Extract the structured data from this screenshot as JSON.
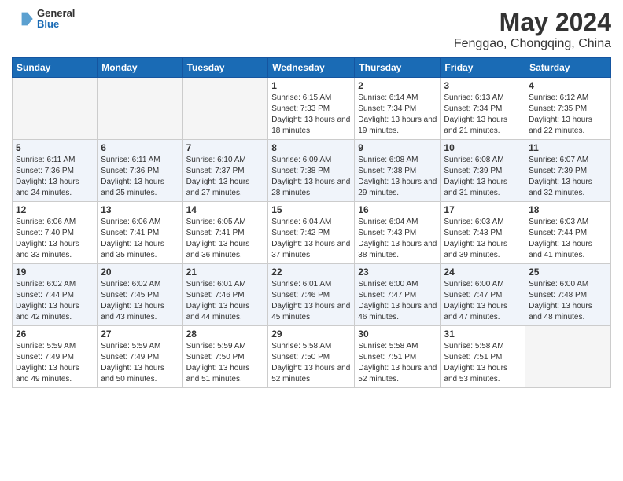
{
  "header": {
    "logo_general": "General",
    "logo_blue": "Blue",
    "title": "May 2024",
    "location": "Fenggao, Chongqing, China"
  },
  "weekdays": [
    "Sunday",
    "Monday",
    "Tuesday",
    "Wednesday",
    "Thursday",
    "Friday",
    "Saturday"
  ],
  "weeks": [
    [
      {
        "day": "",
        "info": ""
      },
      {
        "day": "",
        "info": ""
      },
      {
        "day": "",
        "info": ""
      },
      {
        "day": "1",
        "info": "Sunrise: 6:15 AM\nSunset: 7:33 PM\nDaylight: 13 hours and 18 minutes."
      },
      {
        "day": "2",
        "info": "Sunrise: 6:14 AM\nSunset: 7:34 PM\nDaylight: 13 hours and 19 minutes."
      },
      {
        "day": "3",
        "info": "Sunrise: 6:13 AM\nSunset: 7:34 PM\nDaylight: 13 hours and 21 minutes."
      },
      {
        "day": "4",
        "info": "Sunrise: 6:12 AM\nSunset: 7:35 PM\nDaylight: 13 hours and 22 minutes."
      }
    ],
    [
      {
        "day": "5",
        "info": "Sunrise: 6:11 AM\nSunset: 7:36 PM\nDaylight: 13 hours and 24 minutes."
      },
      {
        "day": "6",
        "info": "Sunrise: 6:11 AM\nSunset: 7:36 PM\nDaylight: 13 hours and 25 minutes."
      },
      {
        "day": "7",
        "info": "Sunrise: 6:10 AM\nSunset: 7:37 PM\nDaylight: 13 hours and 27 minutes."
      },
      {
        "day": "8",
        "info": "Sunrise: 6:09 AM\nSunset: 7:38 PM\nDaylight: 13 hours and 28 minutes."
      },
      {
        "day": "9",
        "info": "Sunrise: 6:08 AM\nSunset: 7:38 PM\nDaylight: 13 hours and 29 minutes."
      },
      {
        "day": "10",
        "info": "Sunrise: 6:08 AM\nSunset: 7:39 PM\nDaylight: 13 hours and 31 minutes."
      },
      {
        "day": "11",
        "info": "Sunrise: 6:07 AM\nSunset: 7:39 PM\nDaylight: 13 hours and 32 minutes."
      }
    ],
    [
      {
        "day": "12",
        "info": "Sunrise: 6:06 AM\nSunset: 7:40 PM\nDaylight: 13 hours and 33 minutes."
      },
      {
        "day": "13",
        "info": "Sunrise: 6:06 AM\nSunset: 7:41 PM\nDaylight: 13 hours and 35 minutes."
      },
      {
        "day": "14",
        "info": "Sunrise: 6:05 AM\nSunset: 7:41 PM\nDaylight: 13 hours and 36 minutes."
      },
      {
        "day": "15",
        "info": "Sunrise: 6:04 AM\nSunset: 7:42 PM\nDaylight: 13 hours and 37 minutes."
      },
      {
        "day": "16",
        "info": "Sunrise: 6:04 AM\nSunset: 7:43 PM\nDaylight: 13 hours and 38 minutes."
      },
      {
        "day": "17",
        "info": "Sunrise: 6:03 AM\nSunset: 7:43 PM\nDaylight: 13 hours and 39 minutes."
      },
      {
        "day": "18",
        "info": "Sunrise: 6:03 AM\nSunset: 7:44 PM\nDaylight: 13 hours and 41 minutes."
      }
    ],
    [
      {
        "day": "19",
        "info": "Sunrise: 6:02 AM\nSunset: 7:44 PM\nDaylight: 13 hours and 42 minutes."
      },
      {
        "day": "20",
        "info": "Sunrise: 6:02 AM\nSunset: 7:45 PM\nDaylight: 13 hours and 43 minutes."
      },
      {
        "day": "21",
        "info": "Sunrise: 6:01 AM\nSunset: 7:46 PM\nDaylight: 13 hours and 44 minutes."
      },
      {
        "day": "22",
        "info": "Sunrise: 6:01 AM\nSunset: 7:46 PM\nDaylight: 13 hours and 45 minutes."
      },
      {
        "day": "23",
        "info": "Sunrise: 6:00 AM\nSunset: 7:47 PM\nDaylight: 13 hours and 46 minutes."
      },
      {
        "day": "24",
        "info": "Sunrise: 6:00 AM\nSunset: 7:47 PM\nDaylight: 13 hours and 47 minutes."
      },
      {
        "day": "25",
        "info": "Sunrise: 6:00 AM\nSunset: 7:48 PM\nDaylight: 13 hours and 48 minutes."
      }
    ],
    [
      {
        "day": "26",
        "info": "Sunrise: 5:59 AM\nSunset: 7:49 PM\nDaylight: 13 hours and 49 minutes."
      },
      {
        "day": "27",
        "info": "Sunrise: 5:59 AM\nSunset: 7:49 PM\nDaylight: 13 hours and 50 minutes."
      },
      {
        "day": "28",
        "info": "Sunrise: 5:59 AM\nSunset: 7:50 PM\nDaylight: 13 hours and 51 minutes."
      },
      {
        "day": "29",
        "info": "Sunrise: 5:58 AM\nSunset: 7:50 PM\nDaylight: 13 hours and 52 minutes."
      },
      {
        "day": "30",
        "info": "Sunrise: 5:58 AM\nSunset: 7:51 PM\nDaylight: 13 hours and 52 minutes."
      },
      {
        "day": "31",
        "info": "Sunrise: 5:58 AM\nSunset: 7:51 PM\nDaylight: 13 hours and 53 minutes."
      },
      {
        "day": "",
        "info": ""
      }
    ]
  ]
}
